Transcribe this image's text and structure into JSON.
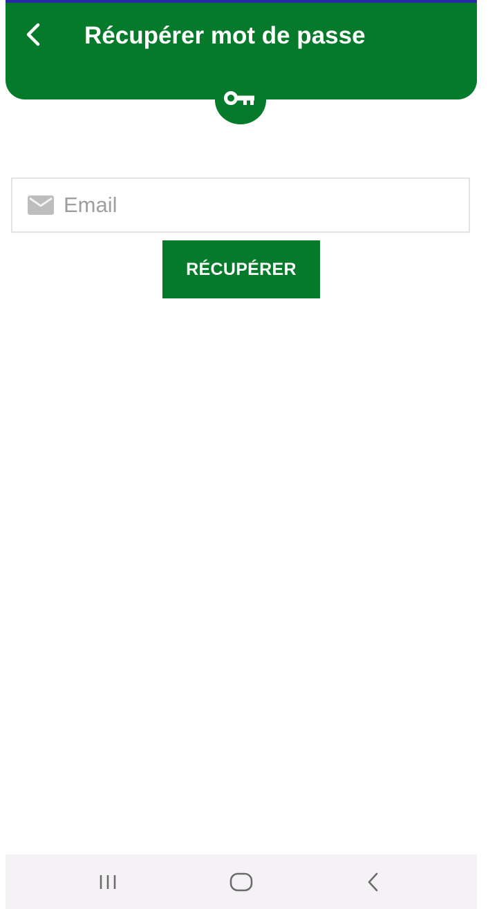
{
  "header": {
    "title": "Récupérer mot de passe",
    "back_icon": "chevron-left-icon",
    "badge_icon": "key-icon"
  },
  "form": {
    "email_placeholder": "Email",
    "email_value": "",
    "email_icon": "mail-icon",
    "submit_label": "RÉCUPÉRER"
  },
  "navbar": {
    "recents_icon": "recents-icon",
    "home_icon": "home-icon",
    "back_icon": "back-icon"
  },
  "colors": {
    "primary": "#057a2a",
    "status_bar": "#2a2aa8",
    "navbar_bg": "#f5f2f5",
    "input_border": "#e4e4e4",
    "placeholder": "#9e9e9e",
    "icon_gray": "#bdbdbd"
  }
}
